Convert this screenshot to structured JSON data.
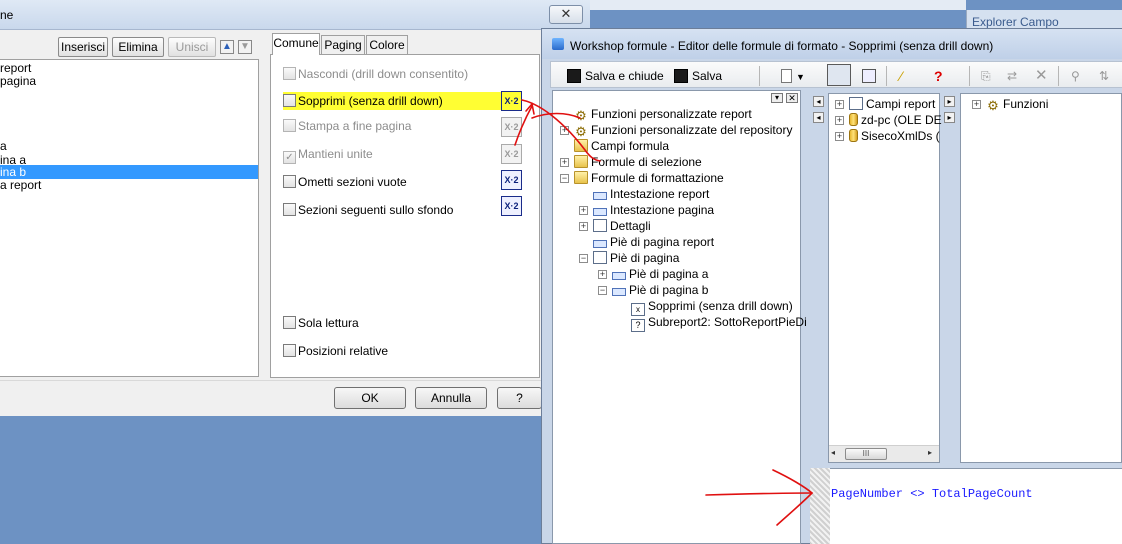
{
  "section_dialog": {
    "title_fragment": "ne",
    "close_glyph": "✕",
    "toolbar": {
      "insert": "Inserisci",
      "delete": "Elimina",
      "merge": "Unisci"
    },
    "sections": [
      "report",
      "pagina",
      "",
      "",
      "",
      "",
      "a",
      "ina a",
      "ina b",
      "a report"
    ],
    "selected_index": 8,
    "tabs": [
      "Comune",
      "Paging",
      "Colore"
    ],
    "options": [
      {
        "label": "Nascondi (drill down consentito)",
        "enabled": false,
        "checked": false
      },
      {
        "label": "Sopprimi (senza drill down)",
        "enabled": true,
        "checked": false,
        "highlighted": true
      },
      {
        "label": "Stampa a fine pagina",
        "enabled": false,
        "checked": false
      },
      {
        "label": "Mantieni unite",
        "enabled": false,
        "checked": true
      },
      {
        "label": "Ometti sezioni vuote",
        "enabled": true,
        "checked": false
      },
      {
        "label": "Sezioni seguenti sullo sfondo",
        "enabled": true,
        "checked": false
      },
      {
        "label": "Sola lettura",
        "enabled": true,
        "checked": false
      },
      {
        "label": "Posizioni relative",
        "enabled": true,
        "checked": false
      }
    ],
    "formula_button_label": "X·2",
    "buttons": {
      "ok": "OK",
      "cancel": "Annulla",
      "help": "?"
    }
  },
  "formula_workshop": {
    "title": "Workshop formule  - Editor delle formule di formato - Sopprimi (senza drill down)",
    "toolbar": {
      "save_close": "Salva e chiude",
      "save": "Salva",
      "help": "?"
    },
    "tree": [
      {
        "label": "Funzioni personalizzate report",
        "level": 0,
        "icon": "gear-icon",
        "expander": ""
      },
      {
        "label": "Funzioni personalizzate del repository",
        "level": 0,
        "icon": "gear-icon",
        "expander": "+"
      },
      {
        "label": "Campi formula",
        "level": 0,
        "icon": "folder-icon",
        "expander": ""
      },
      {
        "label": "Formule di selezione",
        "level": 0,
        "icon": "folder-icon",
        "expander": "+"
      },
      {
        "label": "Formule di formattazione",
        "level": 0,
        "icon": "folder-icon",
        "expander": "−"
      },
      {
        "label": "Intestazione report",
        "level": 1,
        "icon": "band-icon",
        "expander": ""
      },
      {
        "label": "Intestazione pagina",
        "level": 1,
        "icon": "band-icon",
        "expander": "+"
      },
      {
        "label": "Dettagli",
        "level": 1,
        "icon": "page-icon",
        "expander": "+"
      },
      {
        "label": "Piè di pagina report",
        "level": 1,
        "icon": "band-icon",
        "expander": ""
      },
      {
        "label": "Piè di pagina",
        "level": 1,
        "icon": "page-icon",
        "expander": "−"
      },
      {
        "label": "Piè di pagina a",
        "level": 2,
        "icon": "band-icon",
        "expander": "+"
      },
      {
        "label": "Piè di pagina b",
        "level": 2,
        "icon": "band-icon",
        "expander": "−"
      },
      {
        "label": "Sopprimi (senza drill down)",
        "level": 3,
        "icon": "formula-icon",
        "expander": ""
      },
      {
        "label": "Subreport2: SottoReportPieDi",
        "level": 3,
        "icon": "subreport-icon",
        "expander": ""
      }
    ],
    "fields_tree": [
      {
        "label": "Campi report",
        "icon": "page-icon"
      },
      {
        "label": "zd-pc (OLE DE",
        "icon": "database-icon"
      },
      {
        "label": "SisecoXmlDs (",
        "icon": "database-icon"
      }
    ],
    "functions_tree": [
      {
        "label": "Funzioni",
        "icon": "gear-icon"
      }
    ],
    "formula_text": "PageNumber <> TotalPageCount",
    "explorer_label": "Explorer Campo",
    "scroll_thumb_label": "III"
  },
  "colors": {
    "highlight": "#fffe33",
    "selection": "#3399ff",
    "formula_text": "#1a1aff",
    "annotation": "#e01010",
    "desktop": "#6d92c3"
  }
}
